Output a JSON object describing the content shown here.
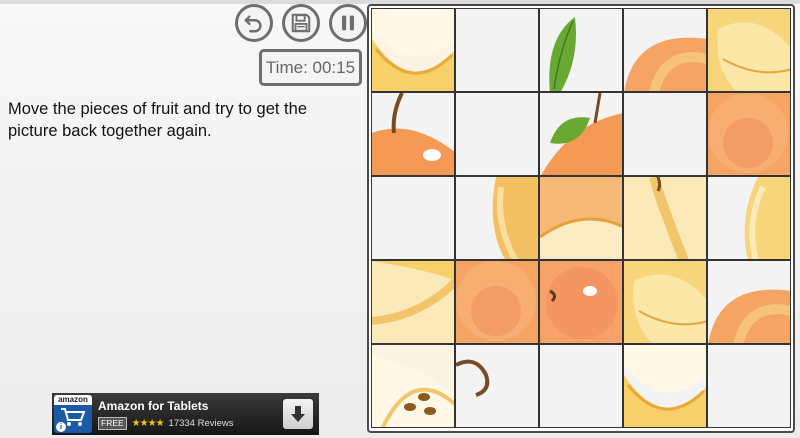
{
  "controls": {
    "undo_icon": "undo-arrow-icon",
    "save_icon": "floppy-disk-icon",
    "pause_icon": "pause-icon"
  },
  "timer": {
    "text": "Time: 00:15"
  },
  "instructions": {
    "text": "Move the pieces of fruit and try to get the picture back together again."
  },
  "ad": {
    "logo_text": "amazon",
    "title": "Amazon for Tablets",
    "badge": "FREE",
    "stars": "★★★★",
    "reviews": "17334 Reviews",
    "download_icon": "download-arrow-icon"
  },
  "puzzle": {
    "rows": 5,
    "cols": 5,
    "tiles": [
      {
        "r": 0,
        "c": 0,
        "bg": "#fbf4e4",
        "shape": "pear-bottom"
      },
      {
        "r": 0,
        "c": 1,
        "bg": "#f3f3f3",
        "shape": "blank"
      },
      {
        "r": 0,
        "c": 2,
        "bg": "#f3f3f3",
        "shape": "leaf"
      },
      {
        "r": 0,
        "c": 3,
        "bg": "#f3f3f3",
        "shape": "orange-corner"
      },
      {
        "r": 0,
        "c": 4,
        "bg": "#f7d57a",
        "shape": "pear-light"
      },
      {
        "r": 1,
        "c": 0,
        "bg": "#f3f3f3",
        "shape": "apple-stem"
      },
      {
        "r": 1,
        "c": 1,
        "bg": "#f3f3f3",
        "shape": "blank"
      },
      {
        "r": 1,
        "c": 2,
        "bg": "#f3f3f3",
        "shape": "leaf-apple"
      },
      {
        "r": 1,
        "c": 3,
        "bg": "#f3f3f3",
        "shape": "blank"
      },
      {
        "r": 1,
        "c": 4,
        "bg": "#f5a463",
        "shape": "orange-full"
      },
      {
        "r": 2,
        "c": 0,
        "bg": "#f3f3f3",
        "shape": "blank"
      },
      {
        "r": 2,
        "c": 1,
        "bg": "#f3f3f3",
        "shape": "pear-edge"
      },
      {
        "r": 2,
        "c": 2,
        "bg": "#f4b877",
        "shape": "pear-slice"
      },
      {
        "r": 2,
        "c": 3,
        "bg": "#fbe9b8",
        "shape": "pear-stem"
      },
      {
        "r": 2,
        "c": 4,
        "bg": "#f3f3f3",
        "shape": "pear-right"
      },
      {
        "r": 3,
        "c": 0,
        "bg": "#f3f3f3",
        "shape": "pear-curve"
      },
      {
        "r": 3,
        "c": 1,
        "bg": "#f7c27a",
        "shape": "orange-full"
      },
      {
        "r": 3,
        "c": 2,
        "bg": "#f6a268",
        "shape": "apple-eye"
      },
      {
        "r": 3,
        "c": 3,
        "bg": "#f8c89a",
        "shape": "pear-light"
      },
      {
        "r": 3,
        "c": 4,
        "bg": "#f3f3f3",
        "shape": "orange-corner"
      },
      {
        "r": 4,
        "c": 0,
        "bg": "#fbf4e4",
        "shape": "apple-seeds"
      },
      {
        "r": 4,
        "c": 1,
        "bg": "#f3f3f3",
        "shape": "stem-curl"
      },
      {
        "r": 4,
        "c": 2,
        "bg": "#f3f3f3",
        "shape": "blank"
      },
      {
        "r": 4,
        "c": 3,
        "bg": "#f3f3f3",
        "shape": "pear-bottom"
      },
      {
        "r": 4,
        "c": 4,
        "bg": "#f3f3f3",
        "shape": "blank"
      }
    ]
  },
  "colors": {
    "button_border": "#6e6e6e",
    "board_border": "#4a4a4a",
    "ad_bg": "#1f1f1f",
    "stars": "#f3c11b"
  }
}
